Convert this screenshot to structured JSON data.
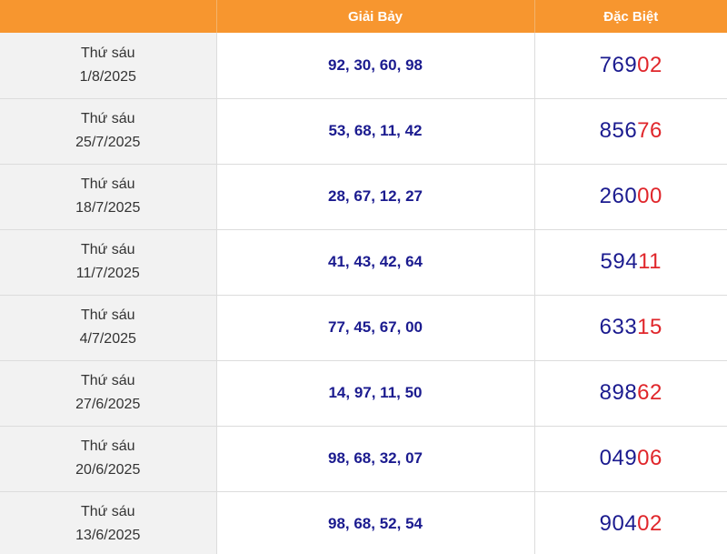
{
  "header": {
    "col_date": "",
    "col_g7": "Giải Bảy",
    "col_db": "Đặc Biệt"
  },
  "colors": {
    "header_bg": "#f7962f",
    "number_blue": "#1b1b8f",
    "number_red": "#e0262b",
    "date_bg": "#f2f2f2"
  },
  "rows": [
    {
      "weekday": "Thứ sáu",
      "date": "1/8/2025",
      "giai_bay": "92, 30, 60, 98",
      "db_head": "769",
      "db_tail": "02"
    },
    {
      "weekday": "Thứ sáu",
      "date": "25/7/2025",
      "giai_bay": "53, 68, 11, 42",
      "db_head": "856",
      "db_tail": "76"
    },
    {
      "weekday": "Thứ sáu",
      "date": "18/7/2025",
      "giai_bay": "28, 67, 12, 27",
      "db_head": "260",
      "db_tail": "00"
    },
    {
      "weekday": "Thứ sáu",
      "date": "11/7/2025",
      "giai_bay": "41, 43, 42, 64",
      "db_head": "594",
      "db_tail": "11"
    },
    {
      "weekday": "Thứ sáu",
      "date": "4/7/2025",
      "giai_bay": "77, 45, 67, 00",
      "db_head": "633",
      "db_tail": "15"
    },
    {
      "weekday": "Thứ sáu",
      "date": "27/6/2025",
      "giai_bay": "14, 97, 11, 50",
      "db_head": "898",
      "db_tail": "62"
    },
    {
      "weekday": "Thứ sáu",
      "date": "20/6/2025",
      "giai_bay": "98, 68, 32, 07",
      "db_head": "049",
      "db_tail": "06"
    },
    {
      "weekday": "Thứ sáu",
      "date": "13/6/2025",
      "giai_bay": "98, 68, 52, 54",
      "db_head": "904",
      "db_tail": "02"
    }
  ]
}
